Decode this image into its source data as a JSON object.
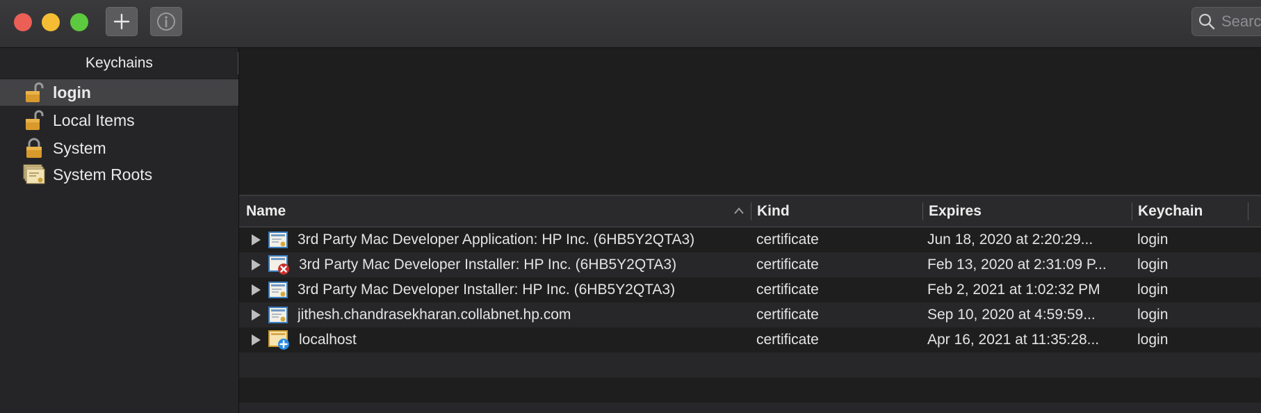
{
  "toolbar": {
    "search_placeholder": "Search",
    "add_icon": "plus-icon",
    "info_icon": "info-icon"
  },
  "sidebar": {
    "header": "Keychains",
    "items": [
      {
        "label": "login",
        "icon": "unlocked-padlock-icon",
        "selected": true
      },
      {
        "label": "Local Items",
        "icon": "unlocked-padlock-icon",
        "selected": false
      },
      {
        "label": "System",
        "icon": "locked-padlock-icon",
        "selected": false
      },
      {
        "label": "System Roots",
        "icon": "certificate-stack-icon",
        "selected": false
      }
    ]
  },
  "table": {
    "columns": [
      "Name",
      "Kind",
      "Expires",
      "Keychain"
    ],
    "sort_column": "Name",
    "rows": [
      {
        "name": "3rd Party Mac Developer Application: HP Inc. (6HB5Y2QTA3)",
        "kind": "certificate",
        "expires": "Jun 18, 2020 at 2:20:29...",
        "keychain": "login",
        "icon": "certificate-icon"
      },
      {
        "name": "3rd Party Mac Developer Installer: HP Inc. (6HB5Y2QTA3)",
        "kind": "certificate",
        "expires": "Feb 13, 2020 at 2:31:09 P...",
        "keychain": "login",
        "icon": "certificate-invalid-icon"
      },
      {
        "name": "3rd Party Mac Developer Installer: HP Inc. (6HB5Y2QTA3)",
        "kind": "certificate",
        "expires": "Feb 2, 2021 at 1:02:32 PM",
        "keychain": "login",
        "icon": "certificate-icon"
      },
      {
        "name": "jithesh.chandrasekharan.collabnet.hp.com",
        "kind": "certificate",
        "expires": "Sep 10, 2020 at 4:59:59...",
        "keychain": "login",
        "icon": "certificate-icon"
      },
      {
        "name": "localhost",
        "kind": "certificate",
        "expires": "Apr 16, 2021 at 11:35:28...",
        "keychain": "login",
        "icon": "certificate-trusted-icon"
      }
    ]
  },
  "colors": {
    "close": "#ec5f56",
    "minimize": "#f4bd33",
    "zoom": "#5dc93f",
    "error_badge": "#c8302c",
    "plus_badge": "#2a8ae6"
  }
}
